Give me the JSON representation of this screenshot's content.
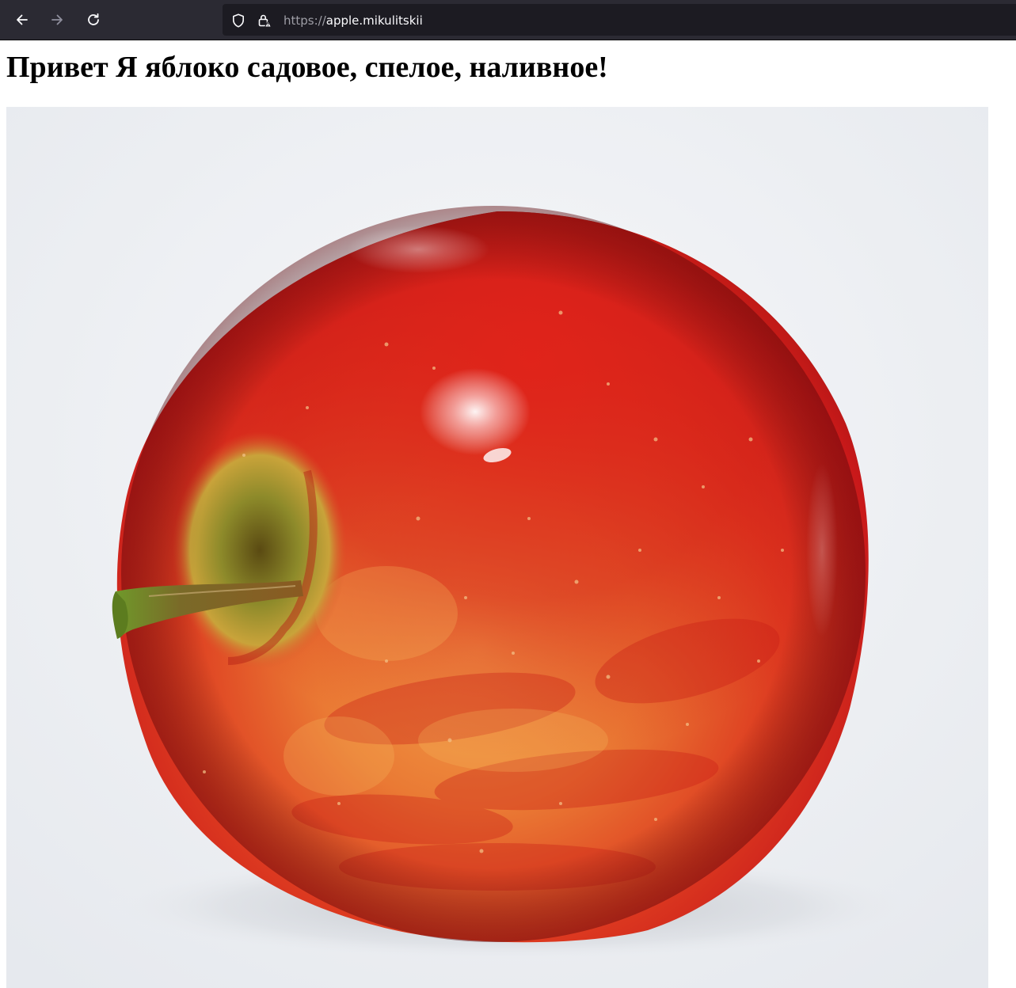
{
  "browser": {
    "url_scheme": "https://",
    "url_host": "apple.mikulitskii",
    "icons": {
      "back": "arrow-left-icon",
      "forward": "arrow-right-icon",
      "reload": "reload-icon",
      "tracking": "shield-icon",
      "security": "insecure-lock-icon"
    }
  },
  "page": {
    "heading": "Привет Я яблоко садовое, спелое, наливное!",
    "image": {
      "subject": "red-apple-photo"
    }
  },
  "colors": {
    "toolbar_bg": "#2b2a33",
    "urlbar_bg": "#1c1b22",
    "apple_red": "#d8231a",
    "apple_yellow": "#f0a040",
    "backdrop": "#eef0f3"
  }
}
